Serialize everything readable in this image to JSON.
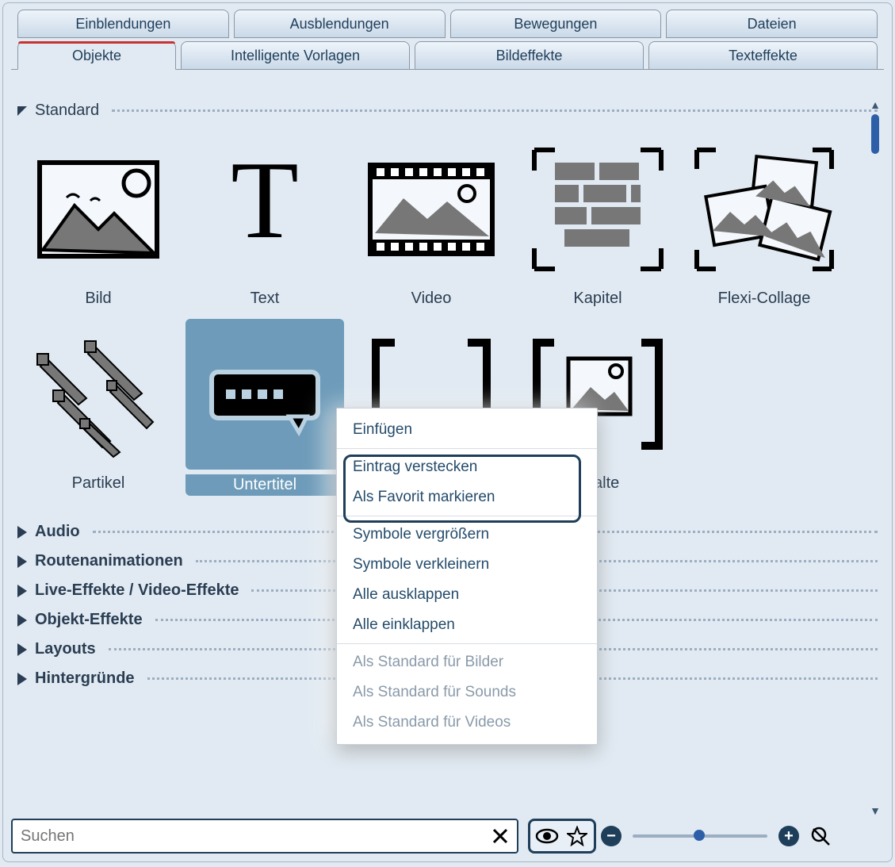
{
  "top_tabs": [
    "Einblendungen",
    "Ausblendungen",
    "Bewegungen",
    "Dateien"
  ],
  "sub_tabs": [
    "Objekte",
    "Intelligente Vorlagen",
    "Bildeffekte",
    "Texteffekte"
  ],
  "active_sub_tab": 0,
  "section_title": "Standard",
  "items": [
    {
      "label": "Bild"
    },
    {
      "label": "Text"
    },
    {
      "label": "Video"
    },
    {
      "label": "Kapitel"
    },
    {
      "label": "Flexi-Collage"
    },
    {
      "label": "Partikel"
    },
    {
      "label": "Untertitel"
    },
    {
      "label": ""
    },
    {
      "label_suffix": "nhalte"
    }
  ],
  "selected_index": 6,
  "folds": [
    "Audio",
    "Routenanimationen",
    "Live-Effekte / Video-Effekte",
    "Objekt-Effekte",
    "Layouts",
    "Hintergründe"
  ],
  "context_menu": {
    "items": [
      {
        "label": "Einfügen",
        "enabled": true
      },
      {
        "sep": true
      },
      {
        "label": "Eintrag verstecken",
        "enabled": true
      },
      {
        "label": "Als Favorit markieren",
        "enabled": true
      },
      {
        "sep": true
      },
      {
        "label": "Symbole vergrößern",
        "enabled": true
      },
      {
        "label": "Symbole verkleinern",
        "enabled": true
      },
      {
        "label": "Alle ausklappen",
        "enabled": true
      },
      {
        "label": "Alle einklappen",
        "enabled": true
      },
      {
        "sep": true
      },
      {
        "label": "Als Standard für Bilder",
        "enabled": false
      },
      {
        "label": "Als Standard für Sounds",
        "enabled": false
      },
      {
        "label": "Als Standard für Videos",
        "enabled": false
      }
    ]
  },
  "search": {
    "placeholder": "Suchen"
  }
}
